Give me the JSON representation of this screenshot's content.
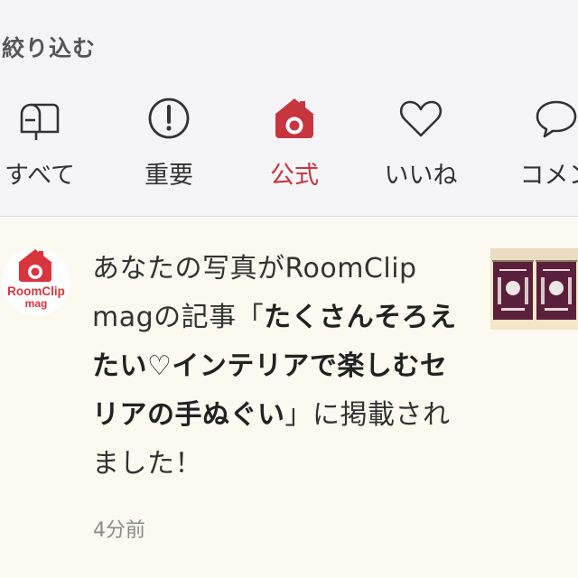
{
  "filter": {
    "title": "絞り込む",
    "tabs": [
      {
        "label": "すべて",
        "icon": "mailbox-icon",
        "active": false
      },
      {
        "label": "重要",
        "icon": "exclamation-circle-icon",
        "active": false
      },
      {
        "label": "公式",
        "icon": "roomclip-house-camera-icon",
        "active": true
      },
      {
        "label": "いいね",
        "icon": "heart-icon",
        "active": false
      },
      {
        "label": "コメン",
        "icon": "speech-bubble-icon",
        "active": false
      }
    ]
  },
  "notification": {
    "avatar_text": {
      "line1": "RoomClip",
      "line2": "mag"
    },
    "message": {
      "part1": "あなたの写真がRoomClip magの記事「",
      "article_title": "たくさんそろえたい♡インテリアで楽しむセリアの手ぬぐい",
      "part2": "」に掲載されました！"
    },
    "time": "4分前"
  },
  "colors": {
    "accent": "#c7363f",
    "panel_bg": "#f5f5f7",
    "notification_bg": "#fcfaf0"
  }
}
